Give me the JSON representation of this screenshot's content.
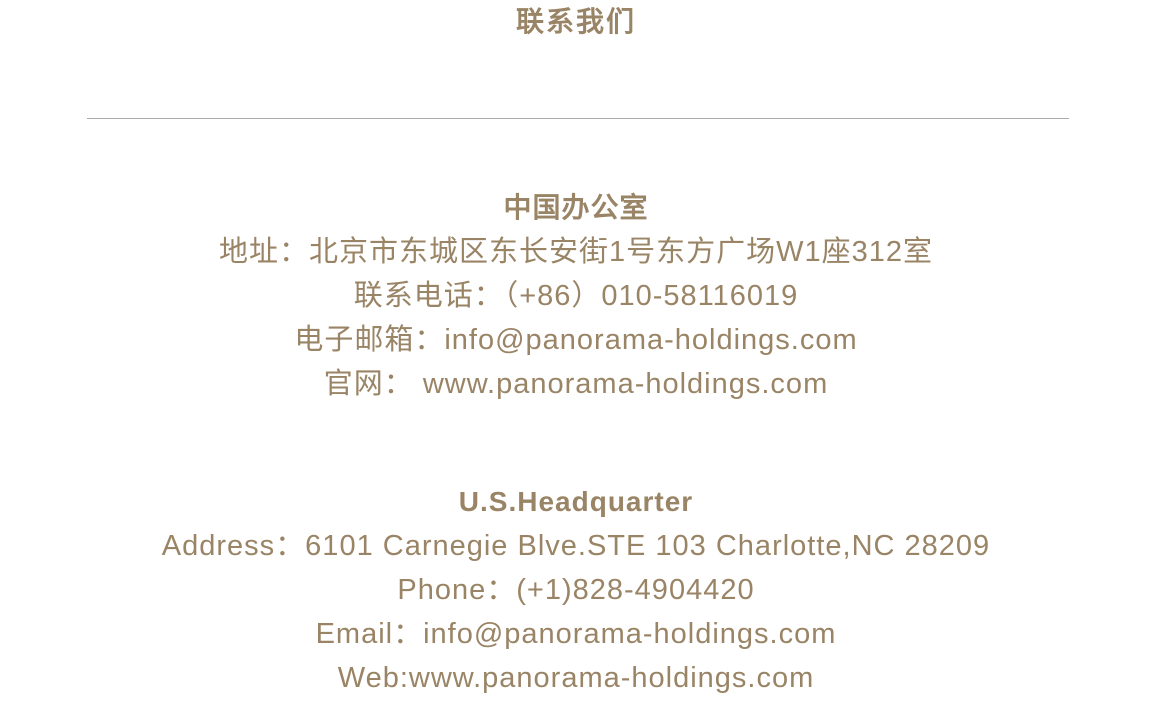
{
  "page_title": "联系我们",
  "china_office": {
    "heading": "中国办公室",
    "address": "地址：北京市东城区东长安街1号东方广场W1座312室",
    "phone": "联系电话：（+86）010-58116019",
    "email": "电子邮箱：info@panorama-holdings.com",
    "website": "官网： www.panorama-holdings.com"
  },
  "us_office": {
    "heading": "U.S.Headquarter",
    "address": "Address：6101 Carnegie Blve.STE 103 Charlotte,NC 28209",
    "phone": "Phone：(+1)828-4904420",
    "email": "Email：info@panorama-holdings.com",
    "website": "Web:www.panorama-holdings.com"
  },
  "colors": {
    "text": "#9a8466",
    "divider": "#aaaaaa",
    "background": "#ffffff"
  }
}
